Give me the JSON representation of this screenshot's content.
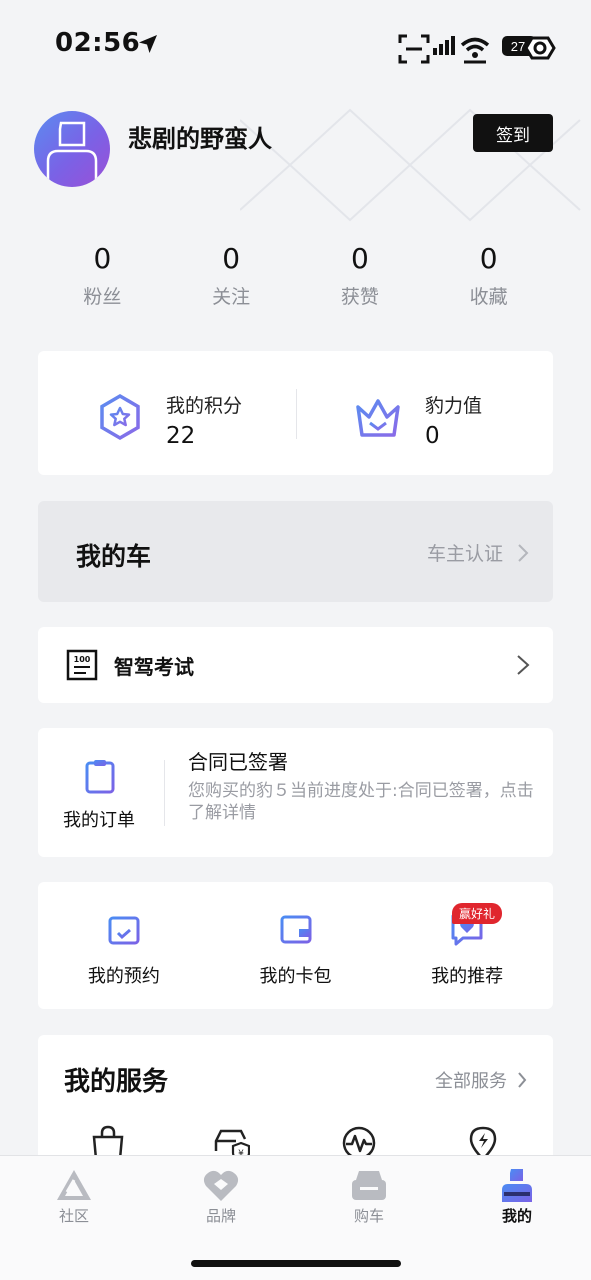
{
  "status_bar": {
    "time": "02:56",
    "battery_level_text": "27"
  },
  "profile": {
    "username": "悲剧的野蛮人",
    "signin_label": "签到"
  },
  "stats": [
    {
      "value": "0",
      "label": "粉丝"
    },
    {
      "value": "0",
      "label": "关注"
    },
    {
      "value": "0",
      "label": "获赞"
    },
    {
      "value": "0",
      "label": "收藏"
    }
  ],
  "points": {
    "my_points_label": "我的积分",
    "my_points_value": "22",
    "power_label": "豹力值",
    "power_value": "0"
  },
  "my_car": {
    "title": "我的车",
    "owner_cert_label": "车主认证"
  },
  "exam": {
    "label": "智驾考试"
  },
  "order": {
    "label": "我的订单",
    "status": "合同已签署",
    "description": "您购买的豹５当前进度处于:合同已签署，点击了解详情"
  },
  "quick": {
    "appointment_label": "我的预约",
    "wallet_label": "我的卡包",
    "recommend_label": "我的推荐",
    "reward_badge": "赢好礼"
  },
  "services": {
    "title": "我的服务",
    "all_label": "全部服务"
  },
  "tabs": [
    {
      "label": "社区"
    },
    {
      "label": "品牌"
    },
    {
      "label": "购车"
    },
    {
      "label": "我的"
    }
  ],
  "colors": {
    "accent_blue": "#4b7cf3",
    "accent_purple": "#7a62e6",
    "badge_red": "#e0262e",
    "signin_bg": "#111111"
  }
}
